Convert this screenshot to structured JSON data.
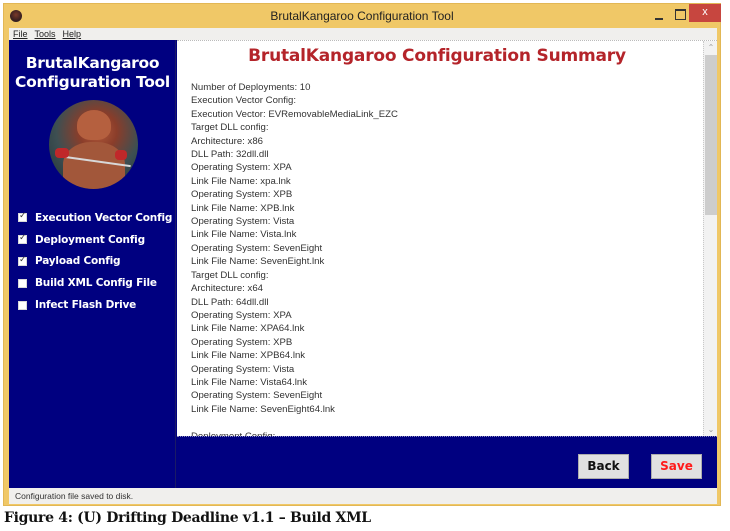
{
  "window": {
    "title": "BrutalKangaroo Configuration Tool",
    "app_icon": "kangaroo-app-icon",
    "controls": {
      "minimize_icon": "minimize-icon",
      "maximize_icon": "maximize-icon",
      "close_label": "x"
    }
  },
  "menu": {
    "items": [
      {
        "label": "File"
      },
      {
        "label": "Tools"
      },
      {
        "label": "Help"
      }
    ]
  },
  "sidebar": {
    "title_line1": "BrutalKangaroo",
    "title_line2": "Configuration Tool",
    "image": "kangaroo-boxer-avatar",
    "steps": [
      {
        "label": "Execution Vector Config",
        "checked": true
      },
      {
        "label": "Deployment Config",
        "checked": true
      },
      {
        "label": "Payload Config",
        "checked": true
      },
      {
        "label": "Build XML Config File",
        "checked": false
      },
      {
        "label": "Infect Flash Drive",
        "checked": false
      }
    ]
  },
  "main": {
    "title": "BrutalKangaroo Configuration Summary",
    "lines": [
      "Number of Deployments: 10",
      "Execution Vector Config:",
      "Execution Vector: EVRemovableMediaLink_EZC",
      "Target DLL config:",
      "Architecture: x86",
      "DLL Path: 32dll.dll",
      "Operating System: XPA",
      "Link File Name: xpa.lnk",
      "Operating System: XPB",
      "Link File Name: XPB.lnk",
      "Operating System: Vista",
      "Link File Name: Vista.lnk",
      "Operating System: SevenEight",
      "Link File Name: SevenEight.lnk",
      "Target DLL config:",
      "Architecture: x64",
      "DLL Path: 64dll.dll",
      "Operating System: XPA",
      "Link File Name: XPA64.lnk",
      "Operating System: XPB",
      "Link File Name: XPB64.lnk",
      "Operating System: Vista",
      "Link File Name: Vista64.lnk",
      "Operating System: SevenEight",
      "Link File Name: SevenEight64.lnk",
      "",
      "Deployment Config:"
    ],
    "scroll_position_percent": 0
  },
  "buttons": {
    "back_label": "Back",
    "save_label": "Save"
  },
  "colors": {
    "navy": "#000080",
    "title_red": "#b4242a",
    "save_red": "#ff1a1a",
    "frame_gold": "#f0c867",
    "close_red": "#c7463f"
  },
  "status": {
    "text": "Configuration file saved to disk."
  },
  "caption": {
    "text": "Figure 4: (U) Drifting Deadline v1.1 – Build XML"
  }
}
